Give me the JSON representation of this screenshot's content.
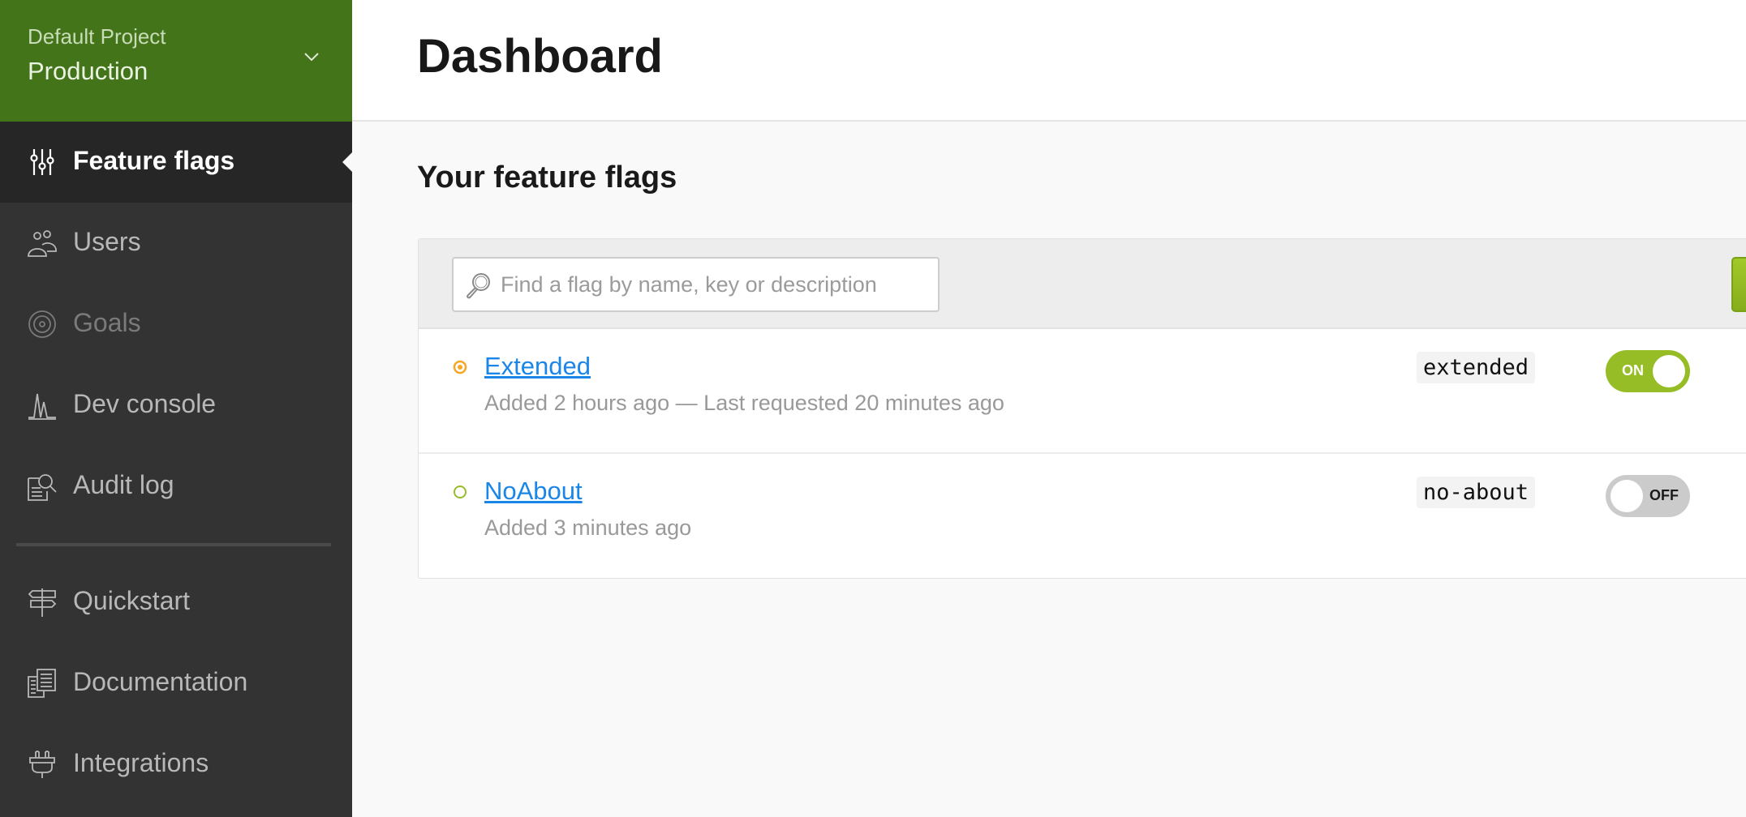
{
  "sidebar": {
    "project": {
      "name": "Default Project",
      "environment": "Production",
      "dropdown_icon": "chevron-down-icon"
    },
    "items": [
      {
        "label": "Feature flags",
        "icon": "sliders-icon",
        "active": true
      },
      {
        "label": "Users",
        "icon": "users-icon"
      },
      {
        "label": "Goals",
        "icon": "target-icon",
        "disabled": true
      },
      {
        "label": "Dev console",
        "icon": "pulse-chart-icon"
      },
      {
        "label": "Audit log",
        "icon": "document-search-icon"
      }
    ],
    "secondary_items": [
      {
        "label": "Quickstart",
        "icon": "signpost-icon"
      },
      {
        "label": "Documentation",
        "icon": "documents-icon"
      },
      {
        "label": "Integrations",
        "icon": "plug-icon"
      }
    ]
  },
  "header": {
    "title": "Dashboard"
  },
  "main": {
    "section_title": "Your feature flags",
    "search": {
      "value": "",
      "placeholder": "Find a flag by name, key or description",
      "icon": "search-icon"
    },
    "flags": [
      {
        "name": "Extended",
        "meta": "Added 2 hours ago — Last requested 20 minutes ago",
        "key": "extended",
        "status_color": "#f5a623",
        "toggle": "ON",
        "enabled": true
      },
      {
        "name": "NoAbout",
        "meta": "Added 3 minutes ago",
        "key": "no-about",
        "status_color": "#97bd26",
        "toggle": "OFF",
        "enabled": false
      }
    ]
  },
  "colors": {
    "brand_green": "#43741a",
    "toggle_on": "#97bd26",
    "link_blue": "#1a86e8",
    "sidebar_bg": "#333333",
    "sidebar_active_bg": "#262626"
  }
}
